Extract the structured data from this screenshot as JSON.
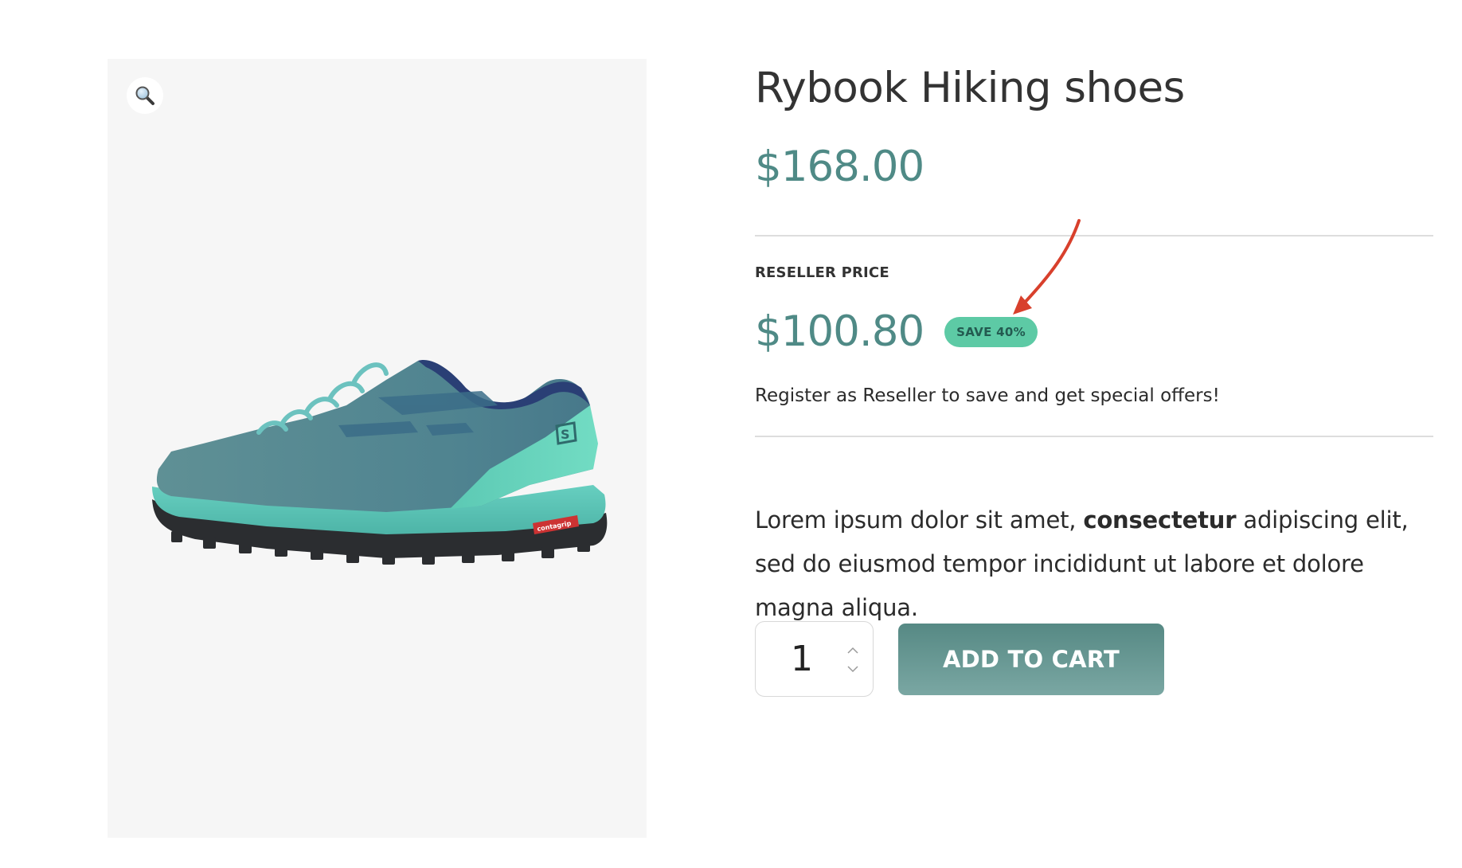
{
  "product": {
    "title": "Rybook Hiking shoes",
    "regular_price": "$168.00",
    "image_icon": "hiking-shoe-image",
    "shoe_logo_text": "contagrip"
  },
  "gallery": {
    "zoom_icon": "magnifier-icon"
  },
  "reseller": {
    "label": "RESELLER PRICE",
    "price": "$100.80",
    "badge": "SAVE 40%",
    "note": "Register as Reseller to save and get special offers!"
  },
  "description": {
    "part1": "Lorem ipsum dolor sit amet, ",
    "bold": "consectetur",
    "part2": " adipiscing elit, sed do eiusmod tempor incididunt ut labore et dolore magna aliqua."
  },
  "cart": {
    "quantity": "1",
    "add_label": "ADD TO CART",
    "increment_icon": "chevron-up-icon",
    "decrement_icon": "chevron-down-icon"
  },
  "colors": {
    "price": "#4f8a86",
    "badge_bg": "#5dcaa5",
    "button": "#5f8f8b",
    "arrow": "#d8402c"
  }
}
